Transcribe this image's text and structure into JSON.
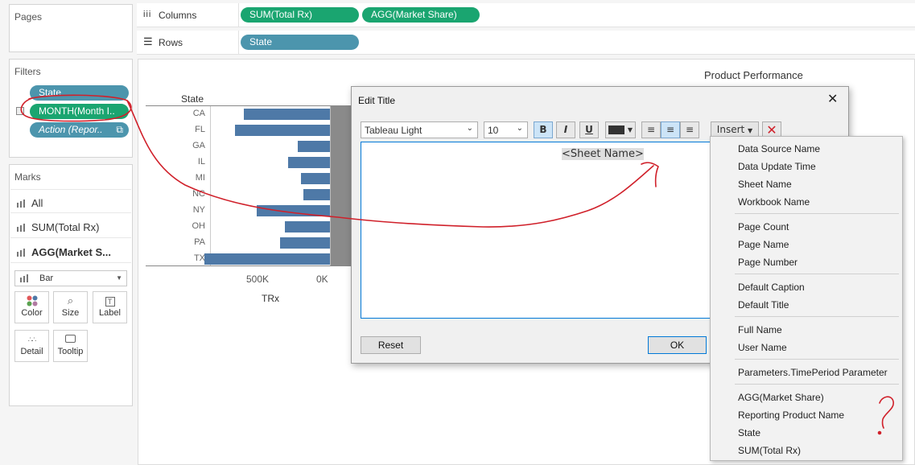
{
  "left_panel": {
    "pages_title": "Pages",
    "filters_title": "Filters",
    "filters": [
      "State",
      "MONTH(Month I..",
      "Action (Repor.."
    ],
    "marks_title": "Marks",
    "marks_items": [
      "All",
      "SUM(Total Rx)",
      "AGG(Market S..."
    ],
    "mark_type": "Bar",
    "cards": [
      "Color",
      "Size",
      "Label",
      "Detail",
      "Tooltip"
    ]
  },
  "shelves": {
    "columns_label": "Columns",
    "columns_pills": [
      "SUM(Total Rx)",
      "AGG(Market Share)"
    ],
    "rows_label": "Rows",
    "rows_pills": [
      "State"
    ]
  },
  "viz": {
    "title": "Product Performance",
    "row_header": "State",
    "axis_ticks": [
      "500K",
      "0K"
    ],
    "axis_title": "TRx"
  },
  "chart_data": {
    "type": "bar",
    "title": "Product Performance",
    "xlabel": "TRx",
    "ylabel": "State",
    "categories": [
      "CA",
      "FL",
      "GA",
      "IL",
      "MI",
      "NC",
      "NY",
      "OH",
      "PA",
      "TX"
    ],
    "series": [
      {
        "values": [
          590000,
          650000,
          220000,
          290000,
          200000,
          180000,
          500000,
          310000,
          340000,
          860000
        ]
      }
    ],
    "xlim": [
      1000000,
      0
    ]
  },
  "dialog": {
    "title": "Edit Title",
    "font_name": "Tableau Light",
    "font_size": "10",
    "bold": "B",
    "italic": "I",
    "underline": "U",
    "insert_label": "Insert",
    "body_text": "<Sheet Name>",
    "reset_label": "Reset",
    "ok_label": "OK"
  },
  "insert_menu": {
    "groups": [
      [
        "Data Source Name",
        "Data Update Time",
        "Sheet Name",
        "Workbook Name"
      ],
      [
        "Page Count",
        "Page Name",
        "Page Number"
      ],
      [
        "Default Caption",
        "Default Title"
      ],
      [
        "Full Name",
        "User Name"
      ],
      [
        "Parameters.TimePeriod Parameter"
      ],
      [
        "AGG(Market Share)",
        "Reporting Product Name",
        "State",
        "SUM(Total Rx)"
      ]
    ]
  },
  "annotation": {
    "mark": "?",
    "color": "#d0202a"
  },
  "colors": {
    "bar": "#4e79a7",
    "pill_green": "#1aa570",
    "pill_blue": "#4c95ad",
    "accent": "#0078d7"
  }
}
